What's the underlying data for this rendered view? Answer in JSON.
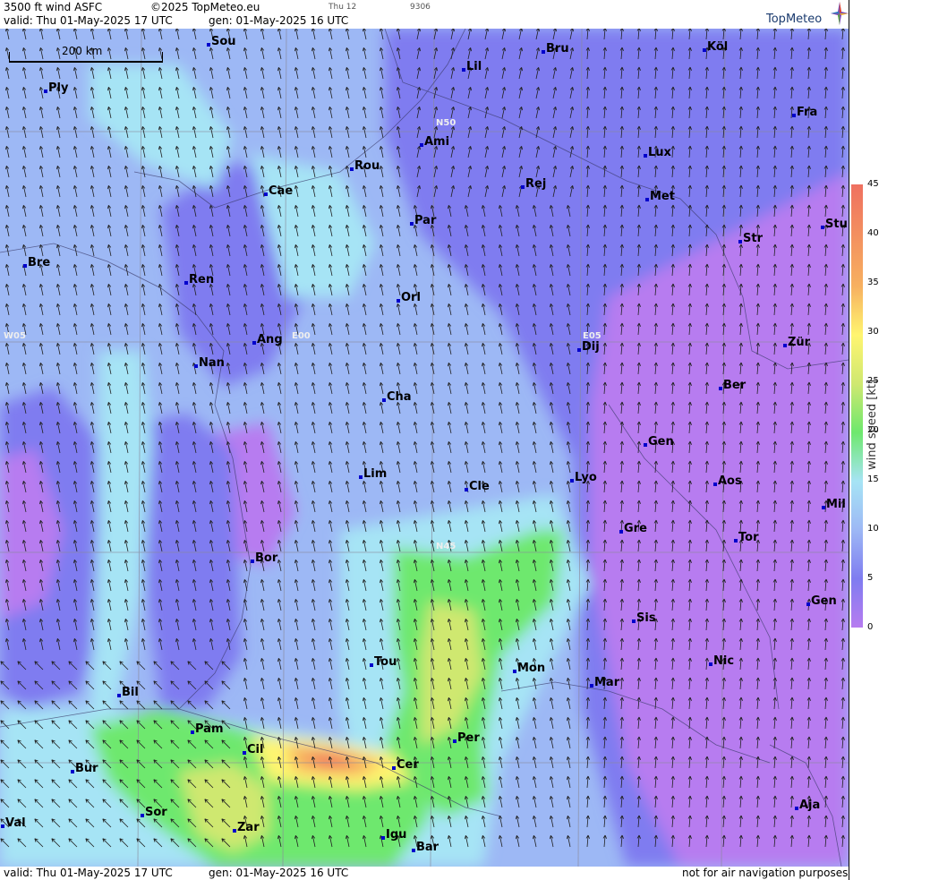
{
  "header": {
    "product": "3500 ft wind ASFC",
    "copyright": "©2025 TopMeteo.eu",
    "step": "Thu 12",
    "code": "9306",
    "valid": "valid:  Thu  01-May-2025  17 UTC",
    "gen": "gen: 01-May-2025 16 UTC",
    "logo": "TopMeteo"
  },
  "footer": {
    "valid": "valid:  Thu  01-May-2025  17 UTC",
    "gen": "gen: 01-May-2025 16 UTC",
    "disclaimer": "not for air navigation purposes"
  },
  "scale": {
    "label": "200 km"
  },
  "grid_labels": [
    "N50",
    "N45",
    "W05",
    "E00",
    "E05"
  ],
  "legend": {
    "title": "wind speed [kt]",
    "ticks": [
      "45",
      "40",
      "35",
      "30",
      "25",
      "20",
      "15",
      "10",
      "5",
      "0"
    ],
    "colors": [
      "#ef7060",
      "#f7b060",
      "#fff570",
      "#cfe870",
      "#6ee86e",
      "#a6e4f5",
      "#9db8f5",
      "#7f7cf0",
      "#b77cf0"
    ]
  },
  "cities": [
    {
      "name": "Sou"
    },
    {
      "name": "Bru"
    },
    {
      "name": "Köl"
    },
    {
      "name": "Ply"
    },
    {
      "name": "Lil"
    },
    {
      "name": "Fra"
    },
    {
      "name": "Ami"
    },
    {
      "name": "Lux"
    },
    {
      "name": "Rou"
    },
    {
      "name": "Cae"
    },
    {
      "name": "Rej"
    },
    {
      "name": "Met"
    },
    {
      "name": "Par"
    },
    {
      "name": "Stu"
    },
    {
      "name": "Bre"
    },
    {
      "name": "Str"
    },
    {
      "name": "Ren"
    },
    {
      "name": "Orl"
    },
    {
      "name": "Ang"
    },
    {
      "name": "Dij"
    },
    {
      "name": "Zür"
    },
    {
      "name": "Nan"
    },
    {
      "name": "Cha"
    },
    {
      "name": "Ber"
    },
    {
      "name": "Gen"
    },
    {
      "name": "Lim"
    },
    {
      "name": "Cle"
    },
    {
      "name": "Lyo"
    },
    {
      "name": "Aos"
    },
    {
      "name": "Mil"
    },
    {
      "name": "Bor"
    },
    {
      "name": "Gre"
    },
    {
      "name": "Tor"
    },
    {
      "name": "Sis"
    },
    {
      "name": "Gen"
    },
    {
      "name": "Tou"
    },
    {
      "name": "Mon"
    },
    {
      "name": "Nic"
    },
    {
      "name": "Mar"
    },
    {
      "name": "Bil"
    },
    {
      "name": "Pam"
    },
    {
      "name": "Per"
    },
    {
      "name": "Cil"
    },
    {
      "name": "Cer"
    },
    {
      "name": "Bur"
    },
    {
      "name": "Sor"
    },
    {
      "name": "Zar"
    },
    {
      "name": "Igu"
    },
    {
      "name": "Val"
    },
    {
      "name": "Bar"
    },
    {
      "name": "Aja"
    }
  ]
}
